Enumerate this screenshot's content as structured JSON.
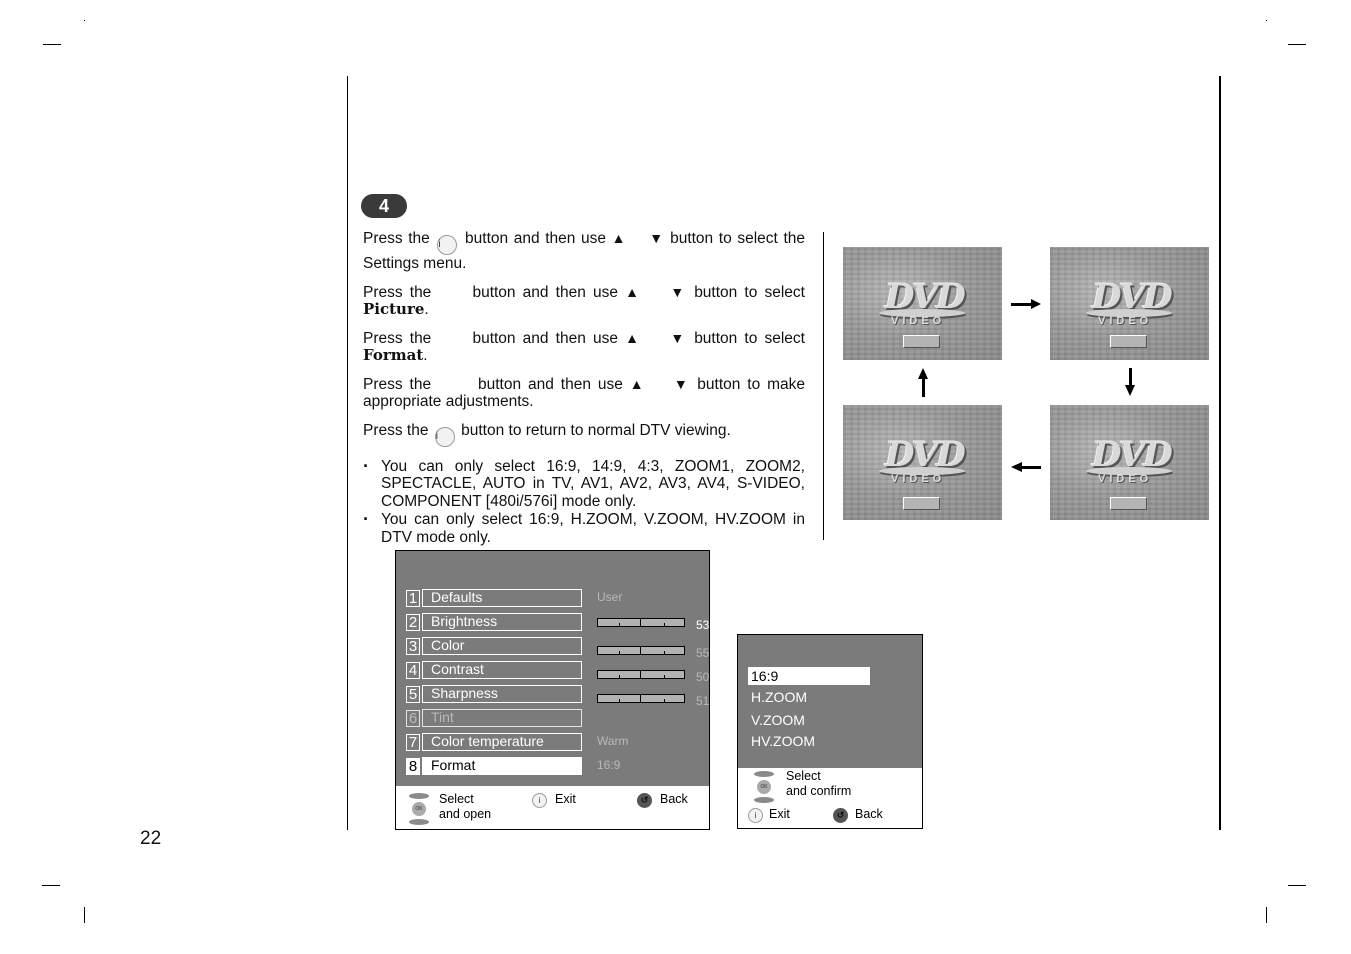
{
  "page": {
    "number": "22",
    "step_number": "4"
  },
  "instructions": {
    "p1": {
      "a": "Press the",
      "btn": "i",
      "b": "button and then use",
      "up": "▲",
      "down": "▼",
      "c": "button to select the Settings menu."
    },
    "p2": {
      "a": "Press the",
      "b": "button and then use",
      "up": "▲",
      "down": "▼",
      "c": "button to select",
      "bold": "Picture",
      "end": "."
    },
    "p3": {
      "a": "Press the",
      "b": "button and then use",
      "up": "▲",
      "down": "▼",
      "c": "button to select",
      "bold": "Format",
      "end": "."
    },
    "p4": {
      "a": "Press the",
      "b": "button and then use",
      "up": "▲",
      "down": "▼",
      "c": "button to make appropriate adjustments."
    },
    "p5": {
      "a": "Press the",
      "btn": "i",
      "b": "button to return to normal DTV viewing."
    },
    "notes": [
      "You can only select 16:9, 14:9, 4:3, ZOOM1, ZOOM2, SPECTACLE, AUTO  in TV, AV1, AV2, AV3, AV4, S-VIDEO, COMPONENT [480i/576i] mode only.",
      "You can only select 16:9, H.ZOOM, V.ZOOM, HV.ZOOM in DTV mode only."
    ]
  },
  "format_cycle": {
    "screens": [
      {
        "logo": "DVD",
        "sub": "VIDEO"
      },
      {
        "logo": "DVD",
        "sub": "VIDEO"
      },
      {
        "logo": "DVD",
        "sub": "VIDEO"
      },
      {
        "logo": "DVD",
        "sub": "VIDEO"
      }
    ],
    "order": [
      "top-left",
      "top-right",
      "bottom-right",
      "bottom-left"
    ]
  },
  "picture_menu": {
    "items": [
      {
        "num": "1",
        "label": "Defaults",
        "value": "User"
      },
      {
        "num": "2",
        "label": "Brightness",
        "slider": 53,
        "value": "53"
      },
      {
        "num": "3",
        "label": "Color",
        "slider": 55,
        "value": "55"
      },
      {
        "num": "4",
        "label": "Contrast",
        "slider": 50,
        "value": "50"
      },
      {
        "num": "5",
        "label": "Sharpness",
        "slider": 51,
        "value": "51"
      },
      {
        "num": "6",
        "label": "Tint",
        "disabled": true
      },
      {
        "num": "7",
        "label": "Color temperature",
        "value": "Warm"
      },
      {
        "num": "8",
        "label": "Format",
        "value": "16:9",
        "selected": true
      }
    ],
    "footer": {
      "nav_label_1": "Select",
      "nav_label_2": "and open",
      "exit_icon": "i",
      "exit_label": "Exit",
      "back_icon": "↺",
      "back_label": "Back",
      "ok_text": "OK"
    }
  },
  "format_menu": {
    "options": [
      {
        "label": "16:9",
        "selected": true
      },
      {
        "label": "H.ZOOM"
      },
      {
        "label": "V.ZOOM"
      },
      {
        "label": "HV.ZOOM"
      }
    ],
    "footer": {
      "nav_label_1": "Select",
      "nav_label_2": "and confirm",
      "exit_icon": "i",
      "exit_label": "Exit",
      "back_icon": "↺",
      "back_label": "Back",
      "ok_text": "OK"
    }
  },
  "colors": {
    "osd_bg": "#7b7b7b",
    "badge_bg": "#3a3a3a"
  }
}
